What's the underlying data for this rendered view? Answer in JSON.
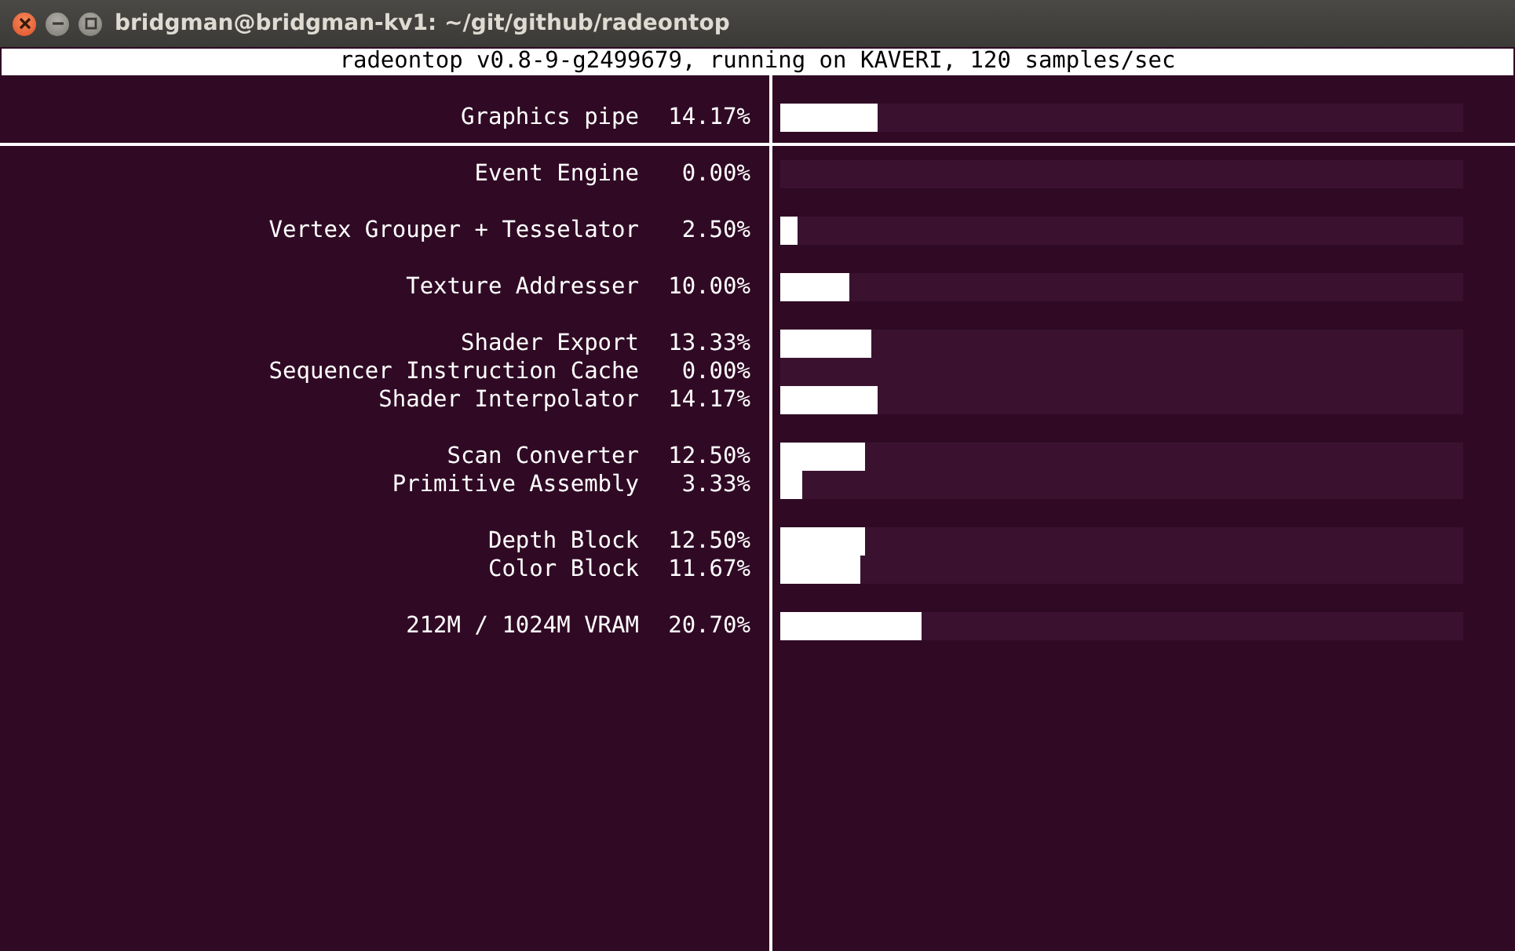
{
  "window": {
    "title": "bridgman@bridgman-kv1: ~/git/github/radeontop"
  },
  "header": "radeontop v0.8-9-g2499679, running on KAVERI, 120 samples/sec",
  "summary": [
    {
      "label": "Graphics pipe",
      "percent": "14.17%",
      "level": 0.1417
    }
  ],
  "groups": [
    {
      "rows": [
        {
          "label": "Event Engine",
          "percent": "0.00%"
        }
      ]
    },
    {
      "rows": [
        {
          "label": "Vertex Grouper + Tesselator",
          "percent": "2.50%",
          "level": 0.025
        }
      ]
    },
    {
      "rows": [
        {
          "label": "Texture Addresser",
          "percent": "10.00%",
          "level": 0.1
        }
      ]
    },
    {
      "rows": [
        {
          "label": "Shader Export",
          "percent": "13.33%",
          "level": 0.1333
        },
        {
          "label": "Sequencer Instruction Cache",
          "percent": "0.00%"
        },
        {
          "label": "Shader Interpolator",
          "percent": "14.17%",
          "level": 0.1417
        }
      ]
    },
    {
      "rows": [
        {
          "label": "Scan Converter",
          "percent": "12.50%",
          "level": 0.125
        },
        {
          "label": "Primitive Assembly",
          "percent": "3.33%",
          "level": 0.0333
        }
      ]
    },
    {
      "rows": [
        {
          "label": "Depth Block",
          "percent": "12.50%",
          "level": 0.125
        },
        {
          "label": "Color Block",
          "percent": "11.67%",
          "level": 0.1167
        }
      ]
    },
    {
      "rows": [
        {
          "label": "212M / 1024M VRAM",
          "percent": "20.70%",
          "level": 0.207
        }
      ]
    }
  ]
}
